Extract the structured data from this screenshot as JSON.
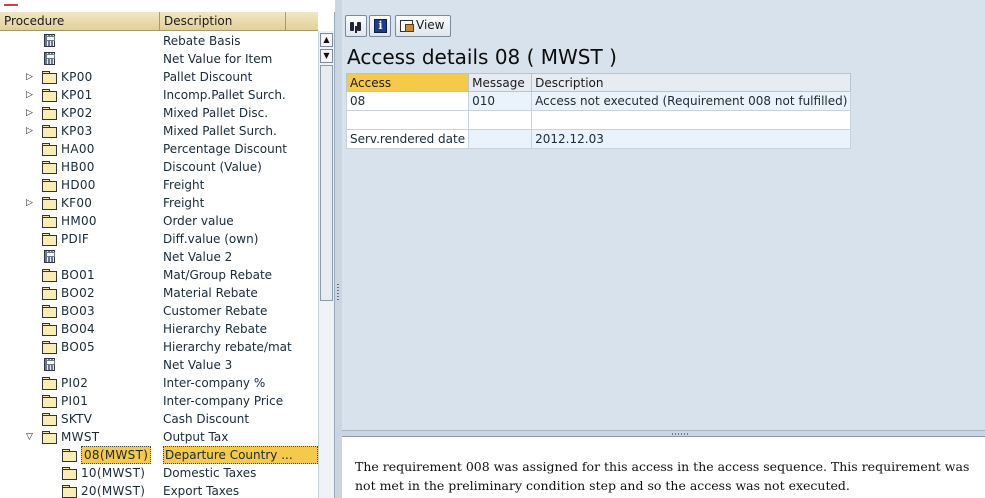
{
  "tree": {
    "columns": {
      "procedure": "Procedure",
      "description": "Description"
    },
    "rows": [
      {
        "code": "",
        "desc": "Rebate Basis",
        "icon": "calculator-icon",
        "expander": "",
        "level": 1
      },
      {
        "code": "",
        "desc": "Net Value for Item",
        "icon": "calculator-icon",
        "expander": "",
        "level": 1
      },
      {
        "code": "KP00",
        "desc": "Pallet Discount",
        "icon": "folder-icon",
        "expander": "collapsed",
        "level": 1
      },
      {
        "code": "KP01",
        "desc": "Incomp.Pallet Surch.",
        "icon": "folder-icon",
        "expander": "collapsed",
        "level": 1
      },
      {
        "code": "KP02",
        "desc": "Mixed Pallet Disc.",
        "icon": "folder-icon",
        "expander": "collapsed",
        "level": 1
      },
      {
        "code": "KP03",
        "desc": "Mixed Pallet Surch.",
        "icon": "folder-icon",
        "expander": "collapsed",
        "level": 1
      },
      {
        "code": "HA00",
        "desc": "Percentage Discount",
        "icon": "folder-icon",
        "expander": "",
        "level": 1
      },
      {
        "code": "HB00",
        "desc": "Discount (Value)",
        "icon": "folder-icon",
        "expander": "",
        "level": 1
      },
      {
        "code": "HD00",
        "desc": "Freight",
        "icon": "folder-icon",
        "expander": "",
        "level": 1
      },
      {
        "code": "KF00",
        "desc": "Freight",
        "icon": "folder-icon",
        "expander": "collapsed",
        "level": 1
      },
      {
        "code": "HM00",
        "desc": "Order value",
        "icon": "folder-icon",
        "expander": "",
        "level": 1
      },
      {
        "code": "PDIF",
        "desc": "Diff.value (own)",
        "icon": "folder-icon",
        "expander": "",
        "level": 1
      },
      {
        "code": "",
        "desc": "Net Value 2",
        "icon": "calculator-icon",
        "expander": "",
        "level": 1
      },
      {
        "code": "BO01",
        "desc": "Mat/Group Rebate",
        "icon": "folder-icon",
        "expander": "",
        "level": 1
      },
      {
        "code": "BO02",
        "desc": "Material Rebate",
        "icon": "folder-icon",
        "expander": "",
        "level": 1
      },
      {
        "code": "BO03",
        "desc": "Customer Rebate",
        "icon": "folder-icon",
        "expander": "",
        "level": 1
      },
      {
        "code": "BO04",
        "desc": "Hierarchy Rebate",
        "icon": "folder-icon",
        "expander": "",
        "level": 1
      },
      {
        "code": "BO05",
        "desc": "Hierarchy rebate/mat",
        "icon": "folder-icon",
        "expander": "",
        "level": 1
      },
      {
        "code": "",
        "desc": "Net Value 3",
        "icon": "calculator-icon",
        "expander": "",
        "level": 1
      },
      {
        "code": "PI02",
        "desc": "Inter-company %",
        "icon": "folder-icon",
        "expander": "",
        "level": 1
      },
      {
        "code": "PI01",
        "desc": "Inter-company Price",
        "icon": "folder-icon",
        "expander": "",
        "level": 1
      },
      {
        "code": "SKTV",
        "desc": "Cash Discount",
        "icon": "folder-icon",
        "expander": "",
        "level": 1
      },
      {
        "code": "MWST",
        "desc": "Output Tax",
        "icon": "open-folder-icon",
        "expander": "expanded",
        "level": 1
      },
      {
        "code": "08(MWST)",
        "desc": "Departure Country ...",
        "icon": "folder-icon",
        "expander": "",
        "level": 2,
        "selected": true
      },
      {
        "code": "10(MWST)",
        "desc": "Domestic Taxes",
        "icon": "folder-icon",
        "expander": "",
        "level": 2
      },
      {
        "code": "20(MWST)",
        "desc": "Export Taxes",
        "icon": "folder-icon",
        "expander": "",
        "level": 2
      }
    ]
  },
  "toolbar": {
    "view_label": "View"
  },
  "detail": {
    "title": "Access details 08 ( MWST )",
    "columns": {
      "access": "Access",
      "message": "Message",
      "description": "Description"
    },
    "rows": [
      {
        "access": "08",
        "message": "010",
        "description": "Access not executed (Requirement 008 not fulfilled)"
      },
      {
        "access": "",
        "message": "",
        "description": ""
      },
      {
        "access": "Serv.rendered date",
        "message": "",
        "description": "2012.12.03"
      }
    ]
  },
  "explanation": {
    "text": "The requirement 008 was assigned for this access in the access sequence. This requirement was not met in the preliminary condition step and so the access was not executed."
  },
  "colors": {
    "selection": "#f5c94a",
    "header_bg": "#e2d09a",
    "panel_bg": "#d8e2ec"
  }
}
